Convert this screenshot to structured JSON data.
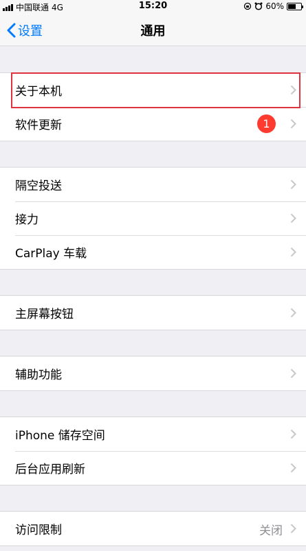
{
  "status_bar": {
    "carrier": "中国联通",
    "network": "4G",
    "time": "15:20",
    "battery": "60%",
    "battery_level": 0.6
  },
  "nav": {
    "back_label": "设置",
    "title": "通用"
  },
  "rows": {
    "about": "关于本机",
    "software_update": "软件更新",
    "software_update_badge": "1",
    "airdrop": "隔空投送",
    "handoff": "接力",
    "carplay": "CarPlay 车载",
    "home_button": "主屏幕按钮",
    "accessibility": "辅助功能",
    "iphone_storage": "iPhone 储存空间",
    "background_refresh": "后台应用刷新",
    "restrictions": "访问限制",
    "restrictions_value": "关闭"
  },
  "colors": {
    "accent": "#007aff",
    "badge": "#ff3b30",
    "highlight": "#e0323c",
    "background": "#efeff4"
  }
}
